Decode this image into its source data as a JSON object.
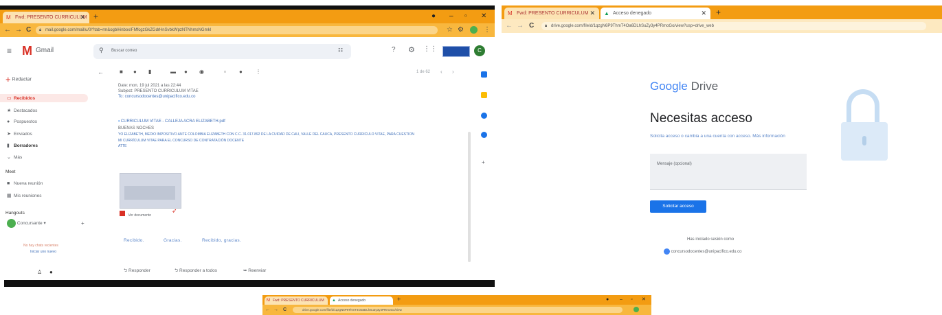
{
  "left_window": {
    "tabs": [
      {
        "label": "Fwd: PRESENTO CURRICULUM",
        "icon": "gmail-icon"
      }
    ],
    "url": "mail.google.com/mail/u/0/?tab=rm&ogbl#inbox/FMfcgzGkZGdrHnSvbkWpzNTNhmsNGmkl",
    "gmail": {
      "logo_text": "Gmail",
      "search_placeholder": "Buscar correo",
      "avatar_letter": "C",
      "compose_label": "Redactar",
      "nav": [
        {
          "label": "Recibidos",
          "icon": "inbox-icon"
        },
        {
          "label": "Destacados",
          "icon": "star-icon"
        },
        {
          "label": "Pospuestos",
          "icon": "clock-icon"
        },
        {
          "label": "Enviados",
          "icon": "send-icon"
        },
        {
          "label": "Borradores",
          "icon": "draft-icon"
        },
        {
          "label": "Más",
          "icon": "chevron-down-icon"
        }
      ],
      "meet_header": "Meet",
      "meet_items": [
        {
          "label": "Nueva reunión",
          "icon": "video-icon"
        },
        {
          "label": "Mis reuniones",
          "icon": "calendar-icon"
        }
      ],
      "hangouts_header": "Hangouts",
      "hangouts_user": "Concursante",
      "no_chats": "No hay chats recientes",
      "start_chat": "Iniciar uno nuevo",
      "page_info": "1 de 62",
      "email": {
        "date": "Date: mon, 19 jul 2021 a las 22:44",
        "subject": "Subject: PRESENTO CURRICULUM VITAE",
        "to": "To: concursodocentes@unipacifico.edu.co",
        "attachment_name": "CURRICULUM VITAE - CALLEJA ACRA ELIZABETH.pdf",
        "greeting": "BUENAS NOCHES",
        "body_line1": "YO ELIZABETH, MEDIO IMPOSITIVO ANTE COLOMBIA ELIZABETH CON C.C. 31.017.892 DE LA CUIDAD DE CALI, VALLE DEL CAUCA, PRESENTO CURRÍCULO VITAE, PARA CUESTIÓN",
        "body_line2": "MI CURRÍCULUM VITAE PARA EL CONCURSO DE CONTRATACIÓN DOCENTE",
        "signature": "ATTE",
        "thumb_caption": "Ver documento"
      },
      "smart_replies": [
        "Recibido.",
        "Gracias.",
        "Recibido, gracias."
      ],
      "actions": {
        "reply": "Responder",
        "reply_all": "Responder a todos",
        "forward": "Reenviar"
      }
    }
  },
  "right_window": {
    "tabs": [
      {
        "label": "Fwd: PRESENTO CURRICULUM",
        "icon": "gmail-icon"
      },
      {
        "label": "Acceso denegado",
        "icon": "drive-icon"
      }
    ],
    "url": "drive.google.com/file/d/1qzgN6P9ThmT4Oa6DLhSuZy3y4PRmoGo/view?usp=drive_web",
    "drive": {
      "logo_google": "Google",
      "logo_drive": "Drive",
      "heading": "Necesitas acceso",
      "subtext": "Solicita acceso o cambia a una cuenta con acceso. Más información",
      "message_placeholder": "Mensaje (opcional)",
      "request_button": "Solicitar acceso",
      "signed_in_label": "Has iniciado sesión como",
      "account": "concursodocentes@unipacifico.edu.co"
    }
  },
  "bottom_window": {
    "tabs": [
      {
        "label": "Fwd: PRESENTO CURRICULUM",
        "icon": "gmail-icon"
      },
      {
        "label": "Acceso denegado",
        "icon": "drive-icon"
      }
    ],
    "url": "drive.google.com/file/d/1qzgN6P9ThmT4Oa6DLhSuZy3y4PRmoGo/view"
  },
  "colors": {
    "tabbar": "#f39c12",
    "addressbar": "#f8b73e",
    "gmail_red": "#d93025",
    "drive_blue": "#4285f4",
    "lock_blue": "#c6ddf3"
  }
}
